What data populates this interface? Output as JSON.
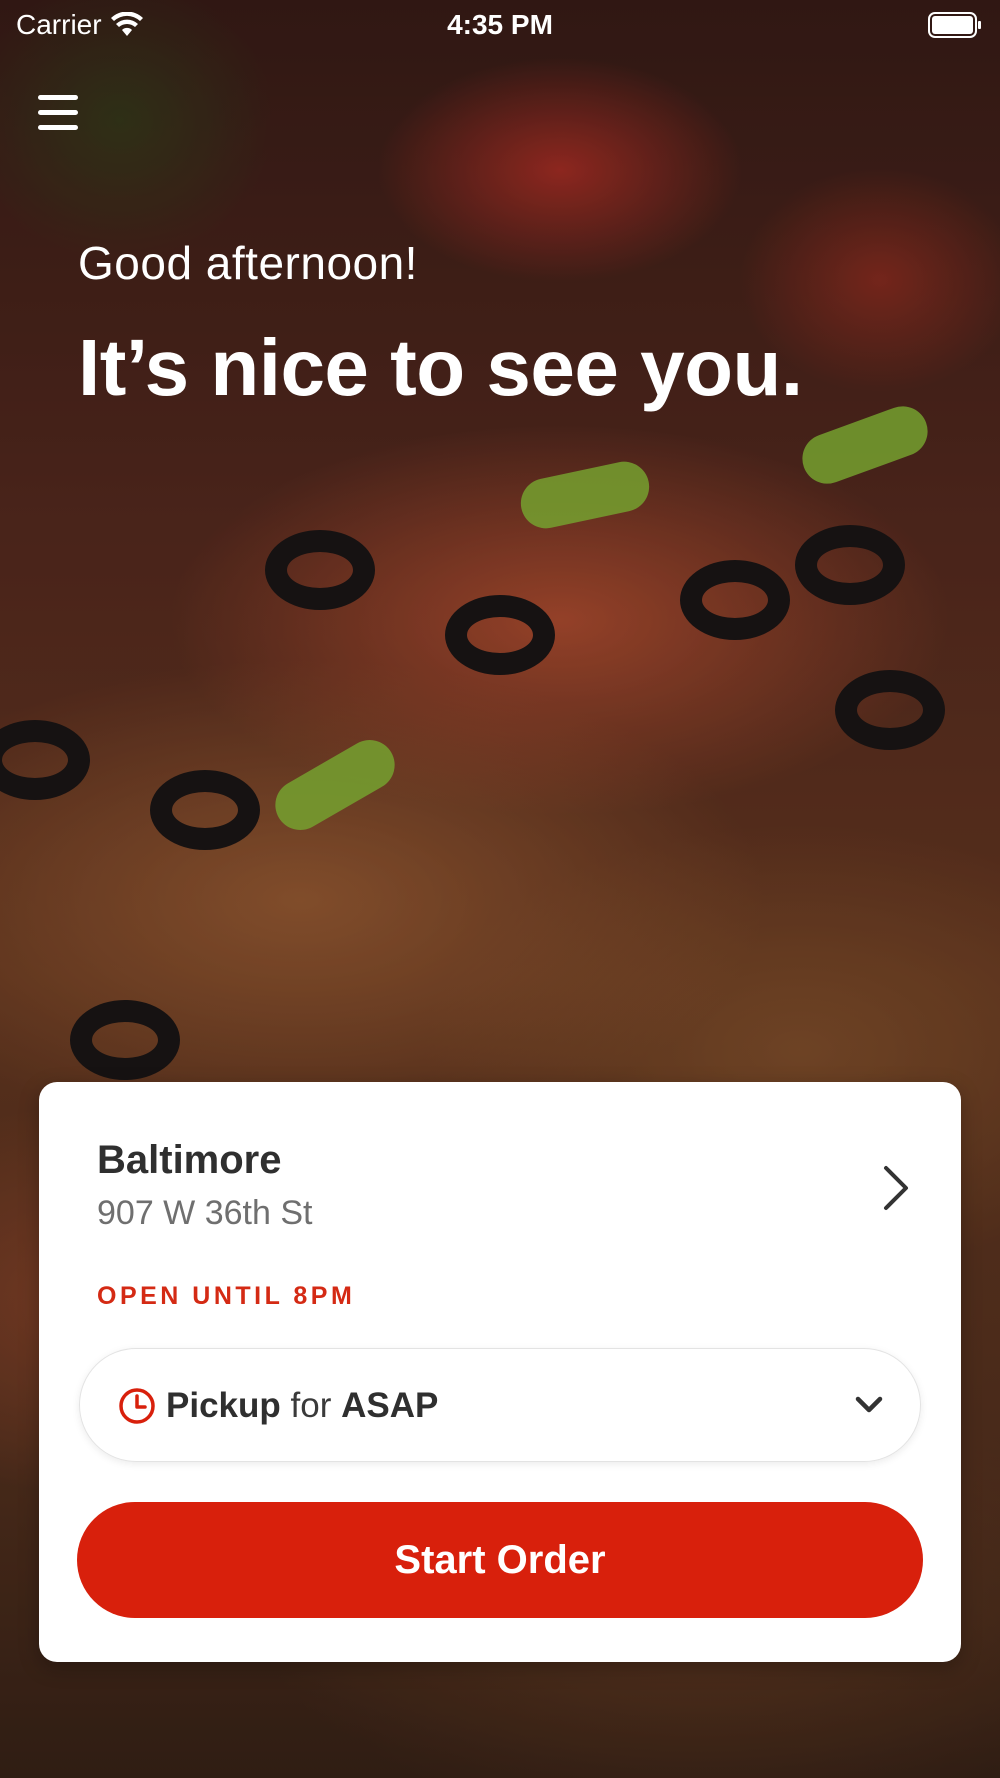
{
  "status_bar": {
    "carrier": "Carrier",
    "time": "4:35 PM"
  },
  "hero": {
    "greeting": "Good afternoon!",
    "headline": "It’s nice to see you."
  },
  "store": {
    "name": "Baltimore",
    "address": "907 W 36th St",
    "hours": "OPEN UNTIL 8PM"
  },
  "order_mode": {
    "mode": "Pickup",
    "connector": "for",
    "time": "ASAP"
  },
  "actions": {
    "start_order": "Start Order"
  },
  "colors": {
    "accent": "#d8200c",
    "hours_text": "#d42a14",
    "card_bg": "#ffffff"
  },
  "icons": [
    "wifi-icon",
    "battery-icon",
    "menu-icon",
    "chevron-right-icon",
    "clock-icon",
    "chevron-down-icon"
  ]
}
